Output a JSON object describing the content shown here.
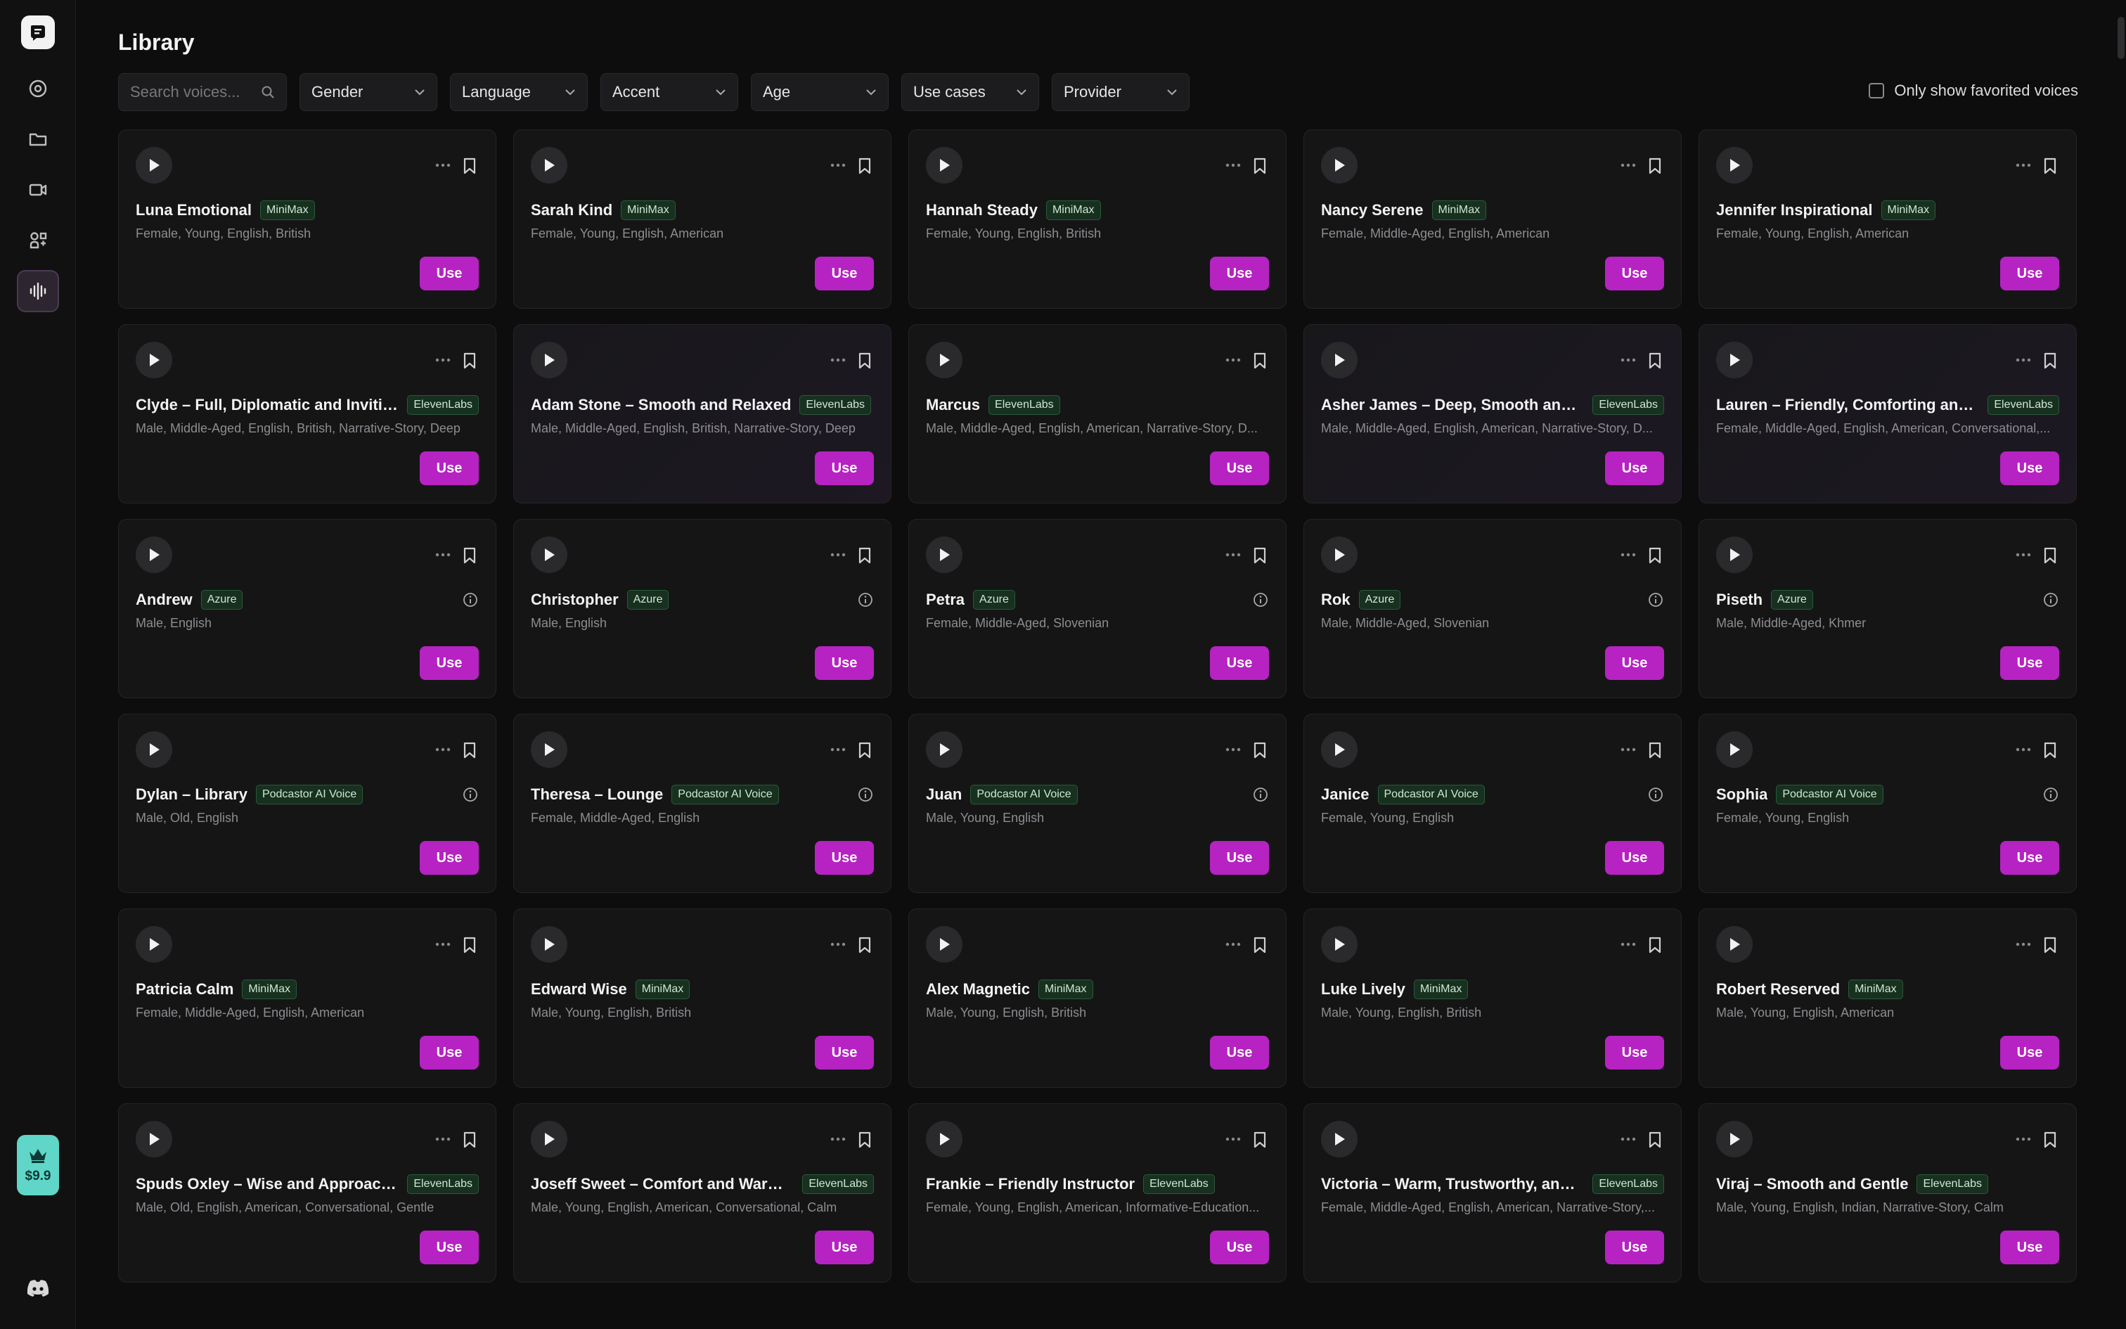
{
  "app": {
    "credit_price": "$9.9"
  },
  "page": {
    "title": "Library"
  },
  "filters": {
    "search_placeholder": "Search voices...",
    "dropdowns": [
      "Gender",
      "Language",
      "Accent",
      "Age",
      "Use cases",
      "Provider"
    ],
    "favorites_label": "Only show favorited voices"
  },
  "use_label": "Use",
  "voices": [
    {
      "name": "Luna Emotional",
      "provider": "MiniMax",
      "tags": "Female, Young, English, British",
      "info": false
    },
    {
      "name": "Sarah Kind",
      "provider": "MiniMax",
      "tags": "Female, Young, English, American",
      "info": false
    },
    {
      "name": "Hannah Steady",
      "provider": "MiniMax",
      "tags": "Female, Young, English, British",
      "info": false
    },
    {
      "name": "Nancy Serene",
      "provider": "MiniMax",
      "tags": "Female, Middle-Aged, English, American",
      "info": false
    },
    {
      "name": "Jennifer Inspirational",
      "provider": "MiniMax",
      "tags": "Female, Young, English, American",
      "info": false
    },
    {
      "name": "Clyde – Full, Diplomatic and Inviting",
      "provider": "ElevenLabs",
      "tags": "Male, Middle-Aged, English, British, Narrative-Story, Deep",
      "info": false
    },
    {
      "name": "Adam Stone – Smooth and Relaxed",
      "provider": "ElevenLabs",
      "tags": "Male, Middle-Aged, English, British, Narrative-Story, Deep",
      "info": false
    },
    {
      "name": "Marcus",
      "provider": "ElevenLabs",
      "tags": "Male, Middle-Aged, English, American, Narrative-Story, D...",
      "info": false
    },
    {
      "name": "Asher James – Deep, Smooth and Ro...",
      "provider": "ElevenLabs",
      "tags": "Male, Middle-Aged, English, American, Narrative-Story, D...",
      "info": false
    },
    {
      "name": "Lauren – Friendly, Comforting and Soft",
      "provider": "ElevenLabs",
      "tags": "Female, Middle-Aged, English, American, Conversational,...",
      "info": false
    },
    {
      "name": "Andrew",
      "provider": "Azure",
      "tags": "Male, English",
      "info": true
    },
    {
      "name": "Christopher",
      "provider": "Azure",
      "tags": "Male, English",
      "info": true
    },
    {
      "name": "Petra",
      "provider": "Azure",
      "tags": "Female, Middle-Aged, Slovenian",
      "info": true
    },
    {
      "name": "Rok",
      "provider": "Azure",
      "tags": "Male, Middle-Aged, Slovenian",
      "info": true
    },
    {
      "name": "Piseth",
      "provider": "Azure",
      "tags": "Male, Middle-Aged, Khmer",
      "info": true
    },
    {
      "name": "Dylan – Library",
      "provider": "Podcastor AI Voice",
      "tags": "Male, Old, English",
      "info": true
    },
    {
      "name": "Theresa – Lounge",
      "provider": "Podcastor AI Voice",
      "tags": "Female, Middle-Aged, English",
      "info": true
    },
    {
      "name": "Juan",
      "provider": "Podcastor AI Voice",
      "tags": "Male, Young, English",
      "info": true
    },
    {
      "name": "Janice",
      "provider": "Podcastor AI Voice",
      "tags": "Female, Young, English",
      "info": true
    },
    {
      "name": "Sophia",
      "provider": "Podcastor AI Voice",
      "tags": "Female, Young, English",
      "info": true
    },
    {
      "name": "Patricia Calm",
      "provider": "MiniMax",
      "tags": "Female, Middle-Aged, English, American",
      "info": false
    },
    {
      "name": "Edward Wise",
      "provider": "MiniMax",
      "tags": "Male, Young, English, British",
      "info": false
    },
    {
      "name": "Alex Magnetic",
      "provider": "MiniMax",
      "tags": "Male, Young, English, British",
      "info": false
    },
    {
      "name": "Luke Lively",
      "provider": "MiniMax",
      "tags": "Male, Young, English, British",
      "info": false
    },
    {
      "name": "Robert Reserved",
      "provider": "MiniMax",
      "tags": "Male, Young, English, American",
      "info": false
    },
    {
      "name": "Spuds Oxley – Wise and Approachable",
      "provider": "ElevenLabs",
      "tags": "Male, Old, English, American, Conversational, Gentle",
      "info": false
    },
    {
      "name": "Joseff Sweet – Comfort and Warmth",
      "provider": "ElevenLabs",
      "tags": "Male, Young, English, American, Conversational, Calm",
      "info": false
    },
    {
      "name": "Frankie – Friendly Instructor",
      "provider": "ElevenLabs",
      "tags": "Female, Young, English, American, Informative-Education...",
      "info": false
    },
    {
      "name": "Victoria – Warm, Trustworthy, and Re...",
      "provider": "ElevenLabs",
      "tags": "Female, Middle-Aged, English, American, Narrative-Story,...",
      "info": false
    },
    {
      "name": "Viraj – Smooth and Gentle",
      "provider": "ElevenLabs",
      "tags": "Male, Young, English, Indian, Narrative-Story, Calm",
      "info": false
    }
  ]
}
